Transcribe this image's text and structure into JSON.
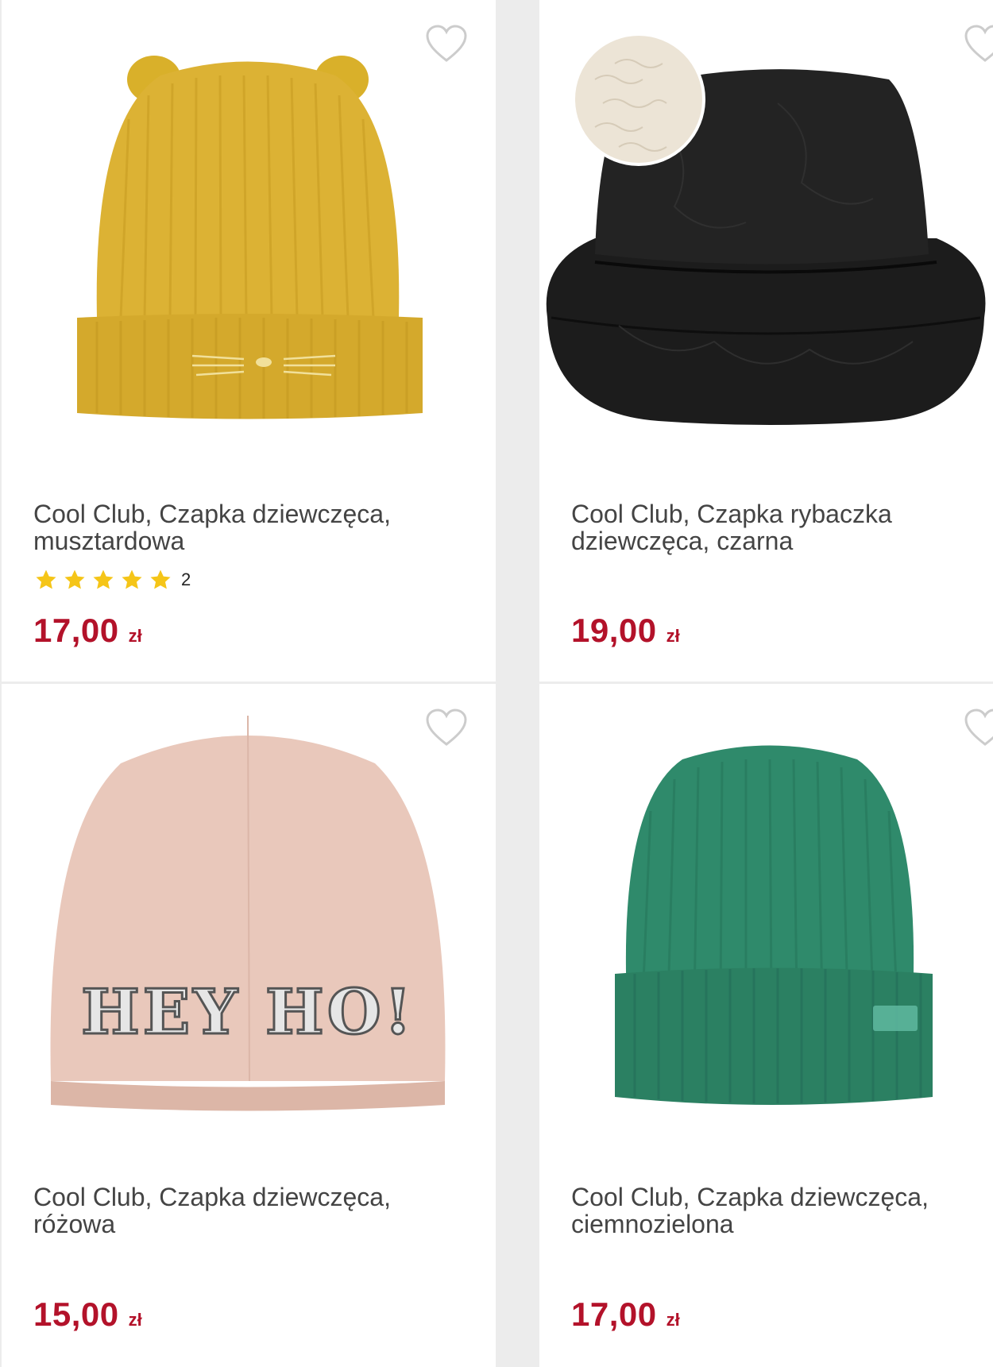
{
  "colors": {
    "price": "#b3122a",
    "star": "#f5c518",
    "heart_outline": "#cccccc"
  },
  "products": [
    {
      "title": "Cool Club, Czapka dziewczęca,\nmusztardowa",
      "price": "17,00",
      "currency": "zł",
      "rating_stars": 5,
      "rating_count": "2",
      "image_icon": "yellow-cat-beanie"
    },
    {
      "title": "Cool Club, Czapka rybaczka\ndziewczęca, czarna",
      "price": "19,00",
      "currency": "zł",
      "image_icon": "black-bucket-hat"
    },
    {
      "title": "Cool Club, Czapka dziewczęca,\nróżowa",
      "price": "15,00",
      "currency": "zł",
      "image_icon": "pink-beanie-hey-ho",
      "image_text": "HEY HO!"
    },
    {
      "title": "Cool Club, Czapka dziewczęca,\nciemnozielona",
      "price": "17,00",
      "currency": "zł",
      "image_icon": "green-beanie"
    }
  ]
}
